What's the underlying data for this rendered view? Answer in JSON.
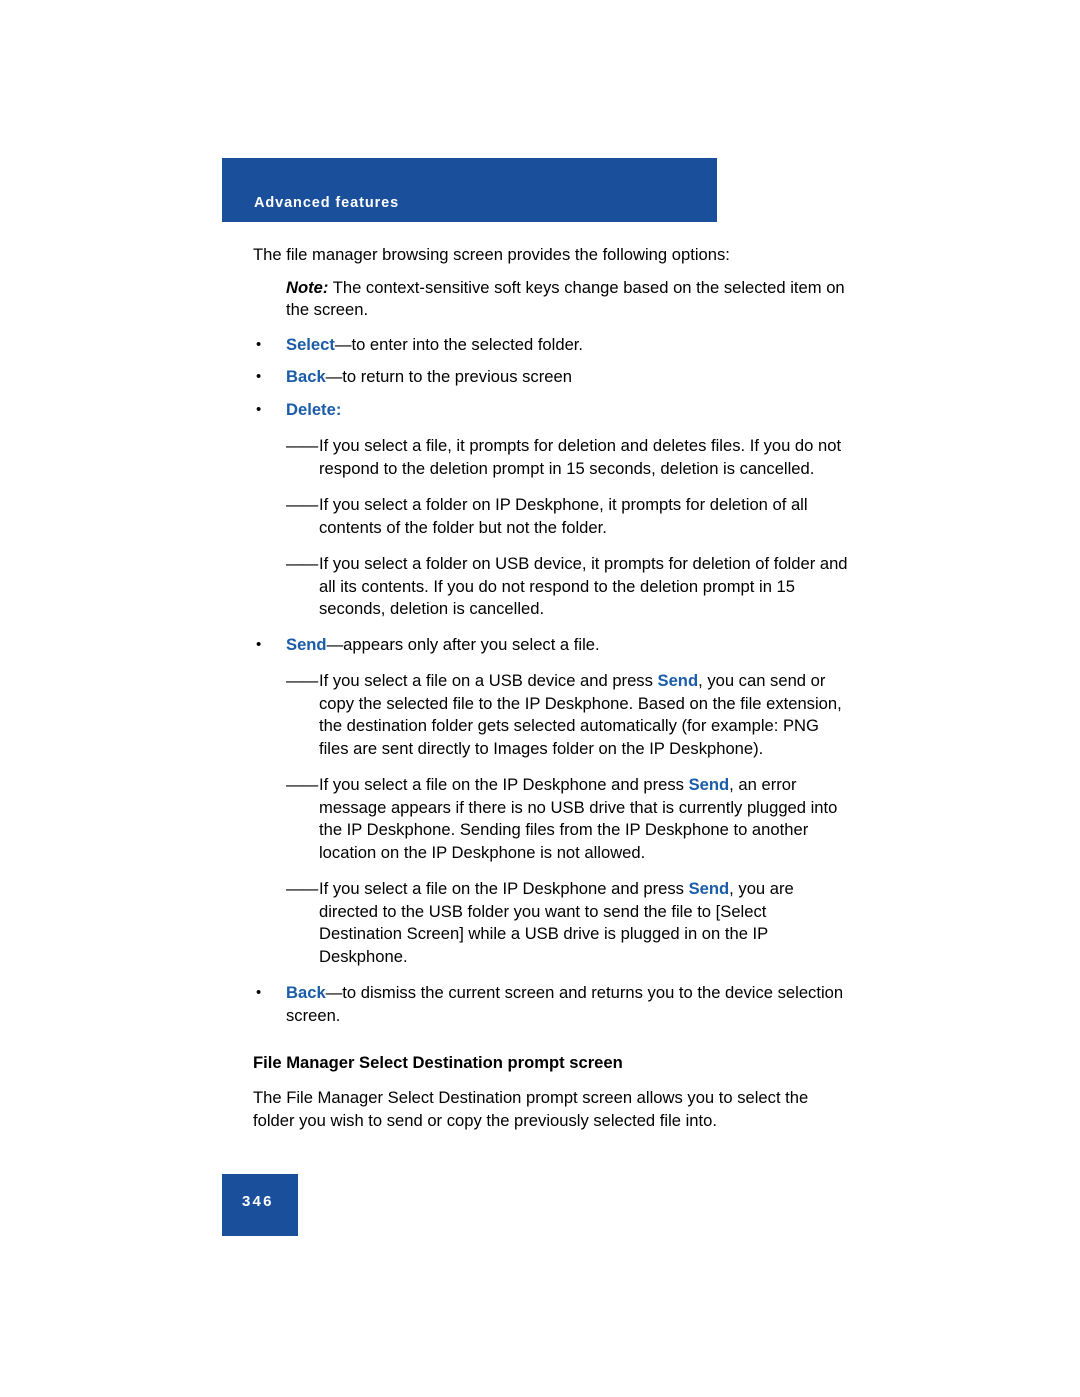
{
  "colors": {
    "header_blue": "#1a4f9c",
    "keyword_blue": "#1a5ca8",
    "text_black": "#000000"
  },
  "header": {
    "title": "Advanced features"
  },
  "body": {
    "intro": "The file manager browsing screen provides the following options:",
    "note_label": "Note:",
    "note_text": " The context-sensitive soft keys change based on the selected item on the screen.",
    "bullets": [
      {
        "keyword": "Select",
        "text": "—to enter into the selected folder."
      },
      {
        "keyword": "Back",
        "text": "—to return to the previous screen"
      },
      {
        "keyword": "Delete",
        "text": ":"
      }
    ],
    "delete_subitems": [
      "If you select a file, it prompts for deletion and deletes files. If you do not respond to the deletion prompt in 15 seconds, deletion is cancelled.",
      "If you select a folder on IP Deskphone, it prompts for deletion of all contents of the folder but not the folder.",
      "If you select a folder on USB device, it prompts for deletion of folder and all its contents. If you do not respond to the deletion prompt in 15 seconds, deletion is cancelled."
    ],
    "send_bullet": {
      "keyword": "Send",
      "text": "—appears only after you select a file."
    },
    "send_sub_1": {
      "part1": "If you select a file on a USB device and press ",
      "kw": "Send",
      "part2": ", you can send or copy the selected file to the IP Deskphone. Based on the file extension, the destination folder gets selected automatically (for example: PNG files are sent directly to Images folder on the IP Deskphone)."
    },
    "send_sub_2": {
      "part1": "If you select a file on the IP Deskphone and press ",
      "kw": "Send",
      "part2": ", an error message appears if there is no USB drive that is currently plugged into the IP Deskphone. Sending files from the IP Deskphone to another location on the IP Deskphone is not allowed."
    },
    "send_sub_3": {
      "part1": "If you select a file on the IP Deskphone and press ",
      "kw": "Send",
      "part2": ", you are directed to the USB folder you want to send the file to [Select Destination Screen] while a USB drive is plugged in on the IP Deskphone."
    },
    "back_bullet": {
      "keyword": "Back",
      "text": "—to dismiss the current screen and returns you to the device selection screen."
    },
    "subheading": "File Manager Select Destination prompt screen",
    "closing": "The File Manager Select Destination prompt screen allows you to select the folder you wish to send or copy the previously selected file into."
  },
  "footer": {
    "page_number": "346"
  },
  "glyphs": {
    "bullet_dot": "•",
    "em_dash": "——"
  }
}
